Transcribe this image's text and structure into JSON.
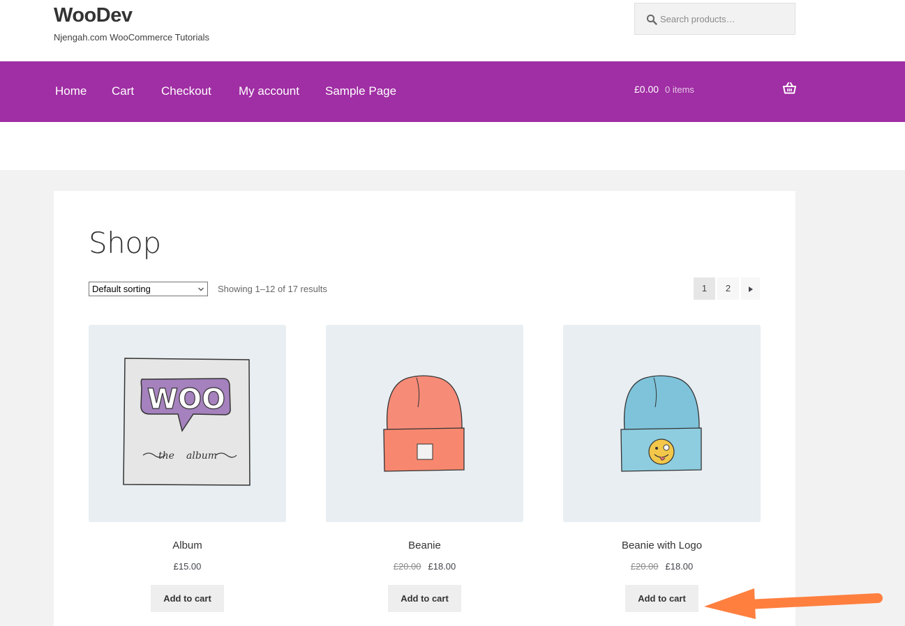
{
  "header": {
    "site_title": "WooDev",
    "site_description": "Njengah.com WooCommerce Tutorials",
    "search_placeholder": "Search products…"
  },
  "nav": {
    "items": [
      "Home",
      "Cart",
      "Checkout",
      "My account",
      "Sample Page"
    ],
    "cart_amount": "£0.00",
    "cart_count": "0 items",
    "color": "#a02ea4"
  },
  "shop": {
    "title": "Shop",
    "sorting": "Default sorting",
    "result_count": "Showing 1–12 of 17 results",
    "pages": [
      "1",
      "2"
    ],
    "current_page": "1",
    "next_icon": "triangle-right-icon"
  },
  "products": [
    {
      "name": "Album",
      "price": "£15.00",
      "regular_price": "",
      "button": "Add to cart",
      "image": "woo-album"
    },
    {
      "name": "Beanie",
      "price": "£18.00",
      "regular_price": "£20.00",
      "button": "Add to cart",
      "image": "orange-beanie"
    },
    {
      "name": "Beanie with Logo",
      "price": "£18.00",
      "regular_price": "£20.00",
      "button": "Add to cart",
      "image": "blue-beanie-emoji"
    }
  ],
  "annotation": {
    "arrow_color": "#ff7f3f",
    "points_to": "Add to cart"
  }
}
